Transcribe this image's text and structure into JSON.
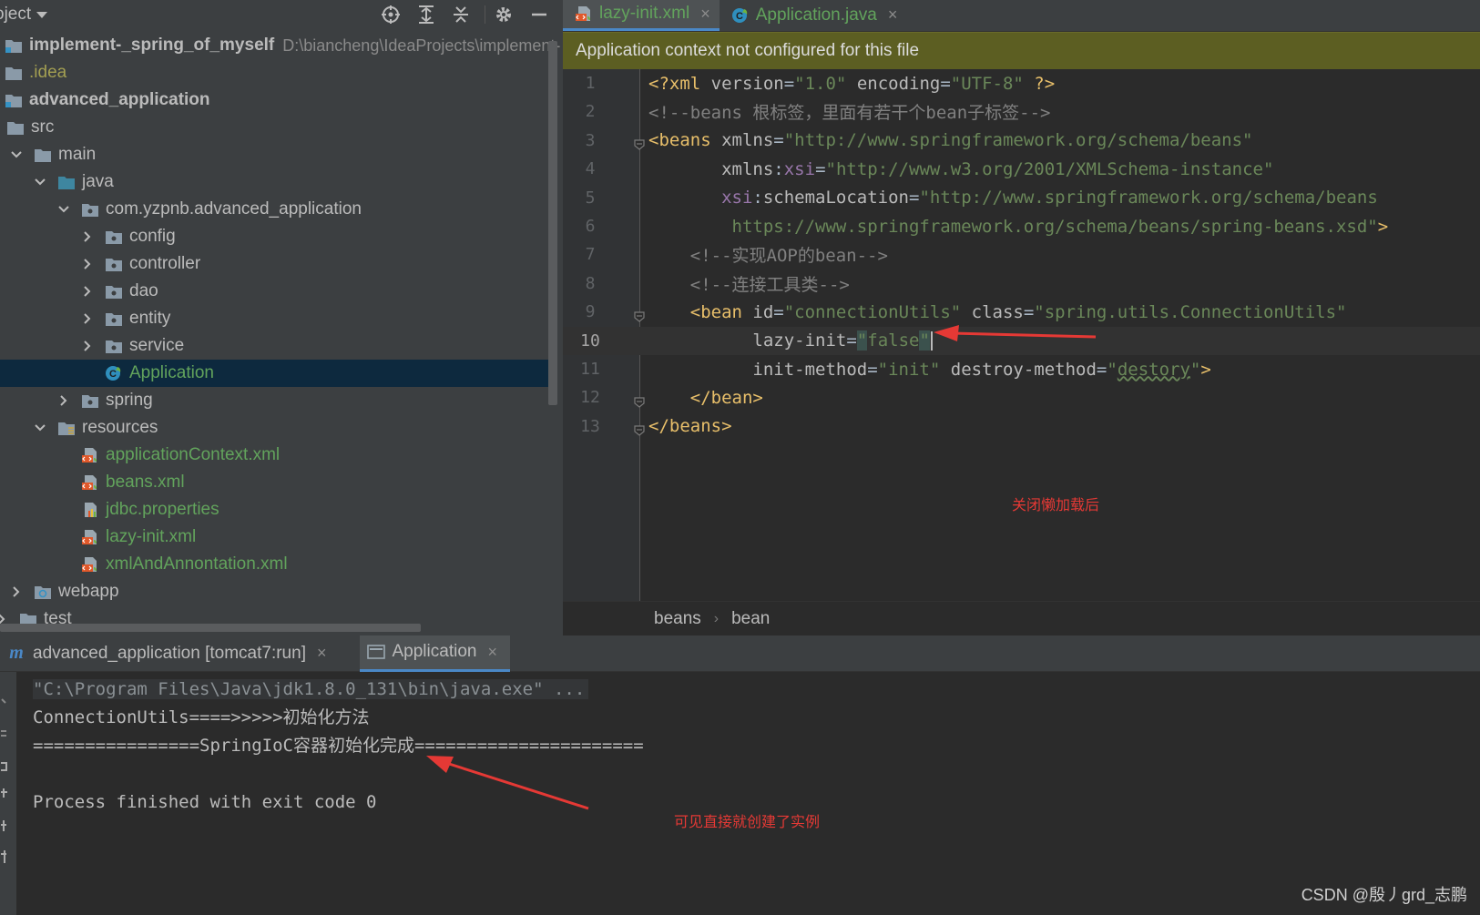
{
  "project_panel": {
    "title": "oject",
    "tree": [
      {
        "label": "implement-_spring_of_myself",
        "path": "D:\\biancheng\\IdeaProjects\\implement-",
        "indent": 0,
        "chevron": "none",
        "icon": "module-icon",
        "bold": true
      },
      {
        "label": ".idea",
        "indent": 0,
        "chevron": "none",
        "icon": "folder-icon",
        "color": "gold"
      },
      {
        "label": "advanced_application",
        "indent": 0,
        "chevron": "none",
        "icon": "module-icon",
        "bold": true
      },
      {
        "label": "src",
        "indent": 0,
        "chevron": "down",
        "icon": "folder-icon"
      },
      {
        "label": "main",
        "indent": 1,
        "chevron": "down",
        "icon": "folder-icon"
      },
      {
        "label": "java",
        "indent": 2,
        "chevron": "down",
        "icon": "source-folder-icon"
      },
      {
        "label": "com.yzpnb.advanced_application",
        "indent": 3,
        "chevron": "down",
        "icon": "package-icon"
      },
      {
        "label": "config",
        "indent": 4,
        "chevron": "right",
        "icon": "package-icon"
      },
      {
        "label": "controller",
        "indent": 4,
        "chevron": "right",
        "icon": "package-icon"
      },
      {
        "label": "dao",
        "indent": 4,
        "chevron": "right",
        "icon": "package-icon"
      },
      {
        "label": "entity",
        "indent": 4,
        "chevron": "right",
        "icon": "package-icon"
      },
      {
        "label": "service",
        "indent": 4,
        "chevron": "right",
        "icon": "package-icon"
      },
      {
        "label": "Application",
        "indent": 4,
        "chevron": "none",
        "icon": "spring-class-icon",
        "color": "green",
        "selected": true
      },
      {
        "label": "spring",
        "indent": 3,
        "chevron": "right",
        "icon": "package-icon"
      },
      {
        "label": "resources",
        "indent": 2,
        "chevron": "down",
        "icon": "resources-folder-icon"
      },
      {
        "label": "applicationContext.xml",
        "indent": 3,
        "chevron": "none",
        "icon": "xml-file-icon",
        "color": "green"
      },
      {
        "label": "beans.xml",
        "indent": 3,
        "chevron": "none",
        "icon": "xml-file-icon",
        "color": "green"
      },
      {
        "label": "jdbc.properties",
        "indent": 3,
        "chevron": "none",
        "icon": "properties-file-icon",
        "color": "green"
      },
      {
        "label": "lazy-init.xml",
        "indent": 3,
        "chevron": "none",
        "icon": "xml-file-icon",
        "color": "green"
      },
      {
        "label": "xmlAndAnnontation.xml",
        "indent": 3,
        "chevron": "none",
        "icon": "xml-file-icon",
        "color": "green"
      },
      {
        "label": "webapp",
        "indent": 1,
        "chevron": "right",
        "icon": "web-folder-icon"
      },
      {
        "label": "test",
        "indent": 0,
        "chevron": "right",
        "icon": "folder-icon"
      }
    ]
  },
  "editor": {
    "tabs": [
      {
        "label": "lazy-init.xml",
        "icon": "xml-file-icon",
        "active": true
      },
      {
        "label": "Application.java",
        "icon": "spring-class-icon",
        "active": false
      }
    ],
    "banner": "Application context not configured for this file",
    "lines": [
      {
        "n": "1",
        "segs": [
          [
            "t-meta",
            "<?xml "
          ],
          [
            "t-attr",
            "version"
          ],
          [
            "t-sq",
            "="
          ],
          [
            "t-val",
            "\"1.0\""
          ],
          [
            "t-attr",
            " encoding"
          ],
          [
            "t-sq",
            "="
          ],
          [
            "t-val",
            "\"UTF-8\""
          ],
          [
            "t-meta",
            " ?>"
          ]
        ]
      },
      {
        "n": "2",
        "segs": [
          [
            "t-com",
            "<!--beans 根标签，里面有若干个bean子标签-->"
          ]
        ]
      },
      {
        "n": "3",
        "fold": true,
        "segs": [
          [
            "t-tag",
            "<beans "
          ],
          [
            "t-attr",
            "xmlns"
          ],
          [
            "t-sq",
            "="
          ],
          [
            "t-val",
            "\"http://www.springframework.org/schema/beans\""
          ]
        ]
      },
      {
        "n": "4",
        "segs": [
          [
            "t-attr",
            "       xmlns"
          ],
          [
            "t-sq",
            ":"
          ],
          [
            "t-ns",
            "xsi"
          ],
          [
            "t-sq",
            "="
          ],
          [
            "t-val",
            "\"http://www.w3.org/2001/XMLSchema-instance\""
          ]
        ]
      },
      {
        "n": "5",
        "segs": [
          [
            "t-ns",
            "       xsi"
          ],
          [
            "t-sq",
            ":"
          ],
          [
            "t-attr",
            "schemaLocation"
          ],
          [
            "t-sq",
            "="
          ],
          [
            "t-val",
            "\"http://www.springframework.org/schema/beans"
          ]
        ]
      },
      {
        "n": "6",
        "segs": [
          [
            "t-val",
            "        https://www.springframework.org/schema/beans/spring-beans.xsd\""
          ],
          [
            "t-tag",
            ">"
          ]
        ]
      },
      {
        "n": "7",
        "segs": [
          [
            "t-com",
            "    <!--实现AOP的bean-->"
          ]
        ]
      },
      {
        "n": "8",
        "segs": [
          [
            "t-com",
            "    <!--连接工具类-->"
          ]
        ]
      },
      {
        "n": "9",
        "fold": true,
        "segs": [
          [
            "t-tag",
            "    <bean "
          ],
          [
            "t-attr",
            "id"
          ],
          [
            "t-sq",
            "="
          ],
          [
            "t-val",
            "\"connectionUtils\""
          ],
          [
            "t-attr",
            " class"
          ],
          [
            "t-sq",
            "="
          ],
          [
            "t-val",
            "\"spring.utils.ConnectionUtils\""
          ]
        ]
      },
      {
        "n": "10",
        "current": true,
        "segs": [
          [
            "t-attr",
            "          lazy-init"
          ],
          [
            "t-sq",
            "="
          ],
          [
            "t-val hl-quote",
            "\""
          ],
          [
            "t-val",
            "false"
          ],
          [
            "t-val hl-quote",
            "\""
          ]
        ]
      },
      {
        "n": "11",
        "segs": [
          [
            "t-attr",
            "          init-method"
          ],
          [
            "t-sq",
            "="
          ],
          [
            "t-val",
            "\"init\""
          ],
          [
            "t-attr",
            " destroy-method"
          ],
          [
            "t-sq",
            "="
          ],
          [
            "t-val",
            "\""
          ],
          [
            "t-val wavy",
            "destory"
          ],
          [
            "t-val",
            "\""
          ],
          [
            "t-tag",
            ">"
          ]
        ]
      },
      {
        "n": "12",
        "fold": true,
        "segs": [
          [
            "t-tag",
            "    </bean>"
          ]
        ]
      },
      {
        "n": "13",
        "fold": true,
        "segs": [
          [
            "t-tag",
            "</beans>"
          ]
        ]
      }
    ],
    "breadcrumb": [
      "beans",
      "bean"
    ],
    "annotation": "关闭懒加载后"
  },
  "run_panel": {
    "tabs": [
      {
        "label": "advanced_application [tomcat7:run]",
        "icon": "maven-icon",
        "active": false
      },
      {
        "label": "Application",
        "icon": "console-icon",
        "active": true
      }
    ],
    "console_lines": [
      "\"C:\\Program Files\\Java\\jdk1.8.0_131\\bin\\java.exe\" ...",
      "ConnectionUtils====>>>>>初始化方法",
      "================SpringIoC容器初始化完成======================",
      "",
      "Process finished with exit code 0"
    ],
    "annotation": "可见直接就创建了实例"
  },
  "watermark": "CSDN @殷丿grd_志鹏",
  "colors": {
    "annotation": "#e53935",
    "banner_bg": "#5c5e22",
    "selection": "#0d293e",
    "tab_underline": "#4a88c7"
  }
}
